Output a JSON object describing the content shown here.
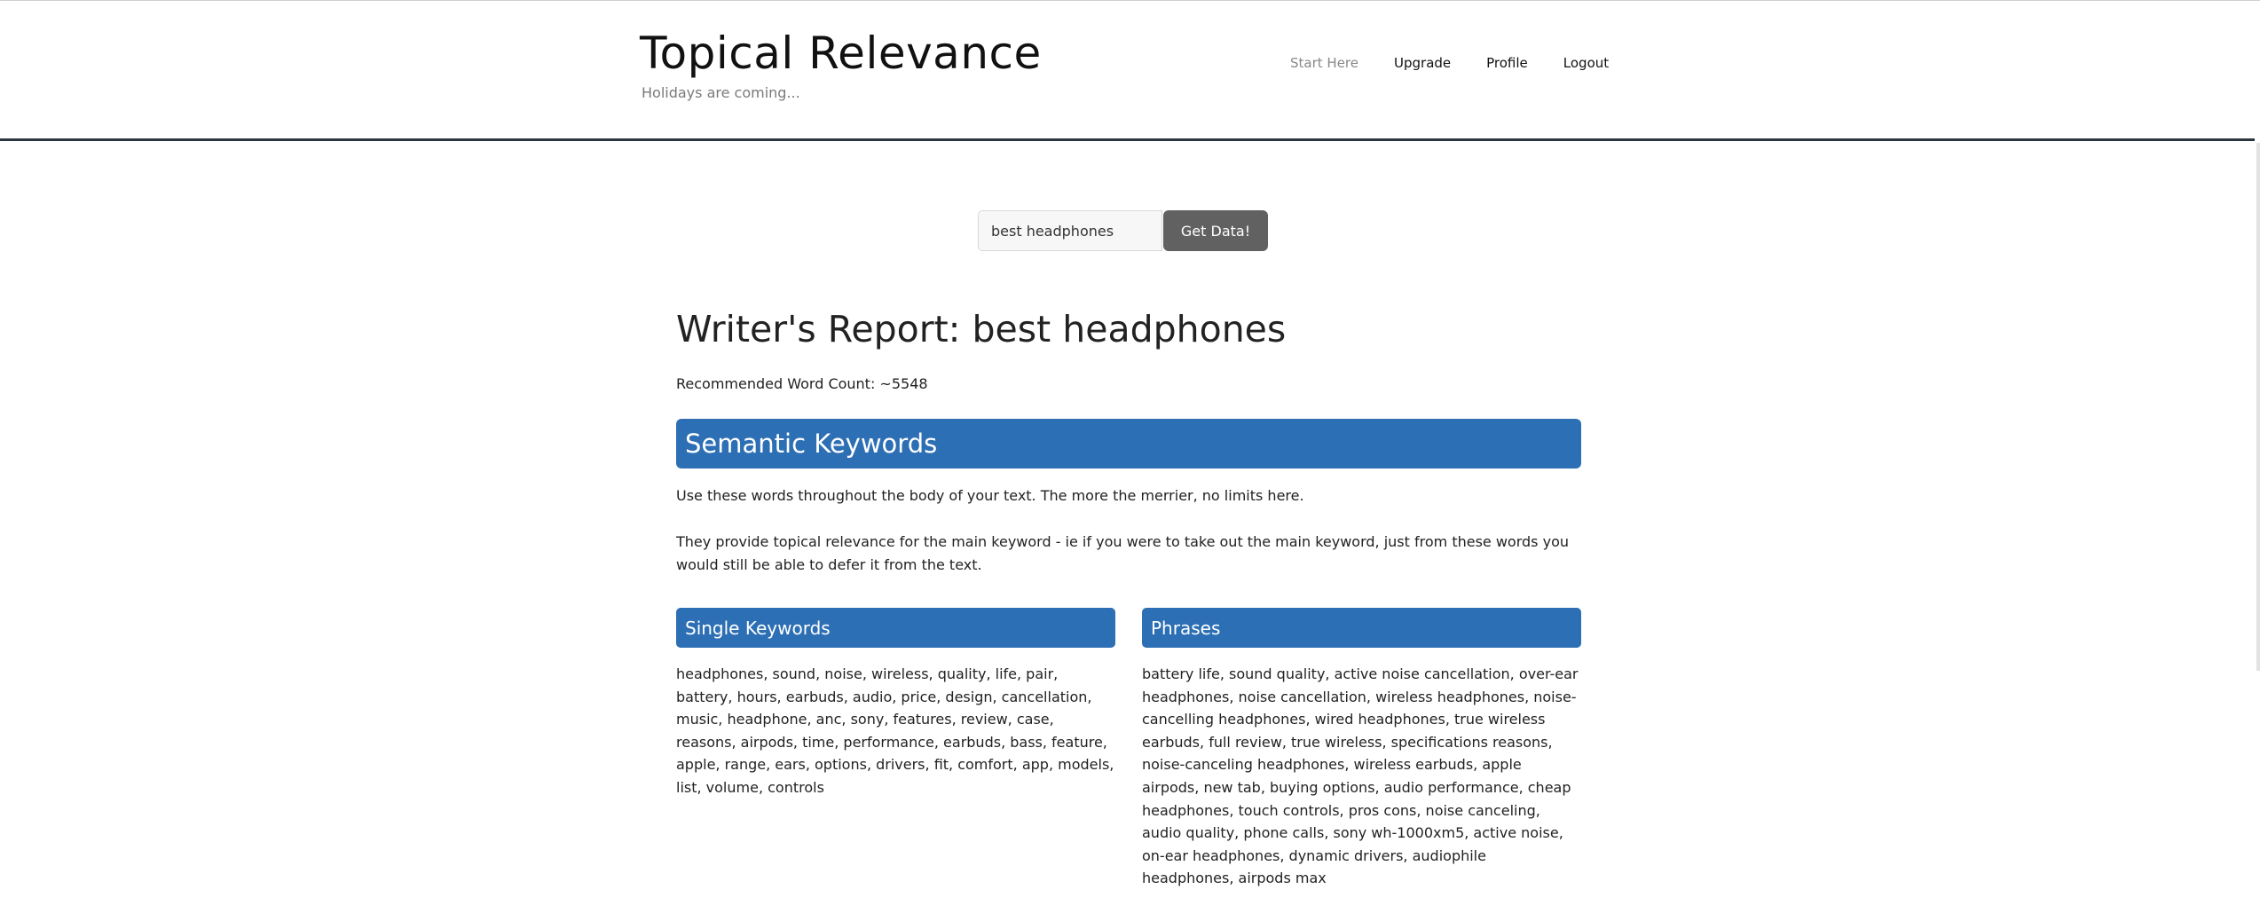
{
  "header": {
    "title": "Topical Relevance",
    "tagline": "Holidays are coming...",
    "nav": [
      {
        "label": "Start Here"
      },
      {
        "label": "Upgrade"
      },
      {
        "label": "Profile"
      },
      {
        "label": "Logout"
      }
    ]
  },
  "search": {
    "value": "best headphones",
    "button_label": "Get Data!"
  },
  "report": {
    "title": "Writer's Report: best headphones",
    "word_count": "Recommended Word Count: ~5548",
    "section_title": "Semantic Keywords",
    "intro_1": "Use these words throughout the body of your text. The more the merrier, no limits here.",
    "intro_2": "They provide topical relevance for the main keyword - ie if you were to take out the main keyword, just from these words you would still be able to defer it from the text.",
    "single_keywords": {
      "heading": "Single Keywords",
      "text": "headphones, sound, noise, wireless, quality, life, pair, battery, hours, earbuds, audio, price, design, cancellation, music, headphone, anc, sony, features, review, case, reasons, airpods, time, performance, earbuds, bass, feature, apple, range, ears, options, drivers, fit, comfort, app, models, list, volume, controls"
    },
    "phrases": {
      "heading": "Phrases",
      "text": "battery life, sound quality, active noise cancellation, over-ear headphones, noise cancellation, wireless headphones, noise-cancelling headphones, wired headphones, true wireless earbuds, full review, true wireless, specifications reasons, noise-canceling headphones, wireless earbuds, apple airpods, new tab, buying options, audio performance, cheap headphones, touch controls, pros cons, noise canceling, audio quality, phone calls, sony wh-1000xm5, active noise, on-ear headphones, dynamic drivers, audiophile headphones, airpods max"
    }
  },
  "colors": {
    "accent": "#2d6fb4",
    "button": "#616161",
    "header_rule": "#2b3540"
  }
}
